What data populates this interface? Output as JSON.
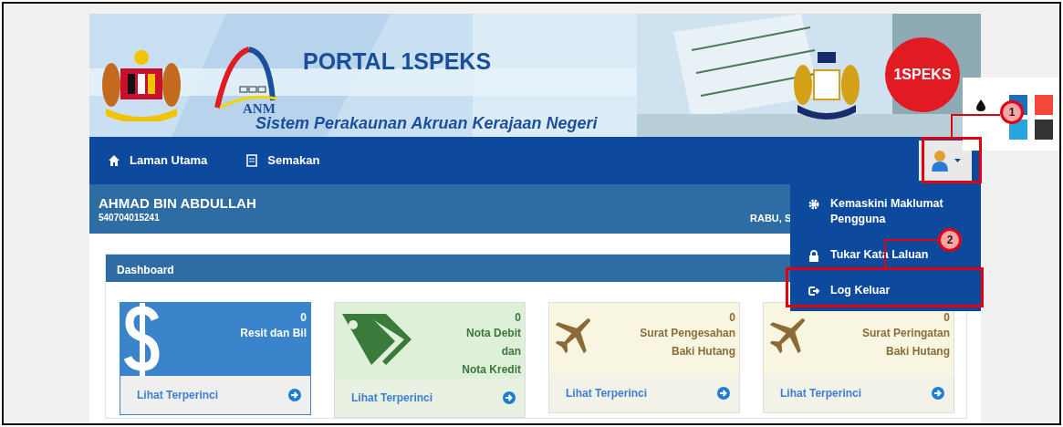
{
  "banner": {
    "title": "PORTAL 1SPEKS",
    "logo_text": "ANM",
    "subtitle": "Sistem Perakaunan Akruan Kerajaan Negeri",
    "badge": "1SPEKS"
  },
  "theme_picker": {
    "swatches": [
      {
        "color": "#1e6fb8"
      },
      {
        "color": "#f4473b"
      },
      {
        "color": "#2aa4e0"
      },
      {
        "color": "#333333"
      }
    ]
  },
  "navbar": {
    "items": [
      {
        "label": "Laman Utama"
      },
      {
        "label": "Semakan"
      }
    ]
  },
  "user_bar": {
    "name": "AHMAD BIN ABDULLAH",
    "id_number": "540704015241",
    "date": "RABU, S"
  },
  "user_menu": {
    "expanded": true,
    "items": [
      {
        "label": "Kemaskini Maklumat Pengguna"
      },
      {
        "label": "Tukar Kata Laluan"
      },
      {
        "label": "Log Keluar"
      }
    ]
  },
  "dashboard": {
    "title": "Dashboard",
    "cards": [
      {
        "kind": "info",
        "count": "0",
        "label": "Resit dan Bil",
        "link": "Lihat Terperinci"
      },
      {
        "kind": "success",
        "count": "0",
        "label": "Nota Debit\ndan\nNota Kredit",
        "link": "Lihat Terperinci"
      },
      {
        "kind": "warning",
        "count": "0",
        "label": "Surat Pengesahan\nBaki Hutang",
        "link": "Lihat Terperinci"
      },
      {
        "kind": "warning",
        "count": "0",
        "label": "Surat Peringatan\nBaki Hutang",
        "link": "Lihat Terperinci"
      }
    ]
  },
  "annotations": [
    {
      "label": "1"
    },
    {
      "label": "2"
    }
  ]
}
